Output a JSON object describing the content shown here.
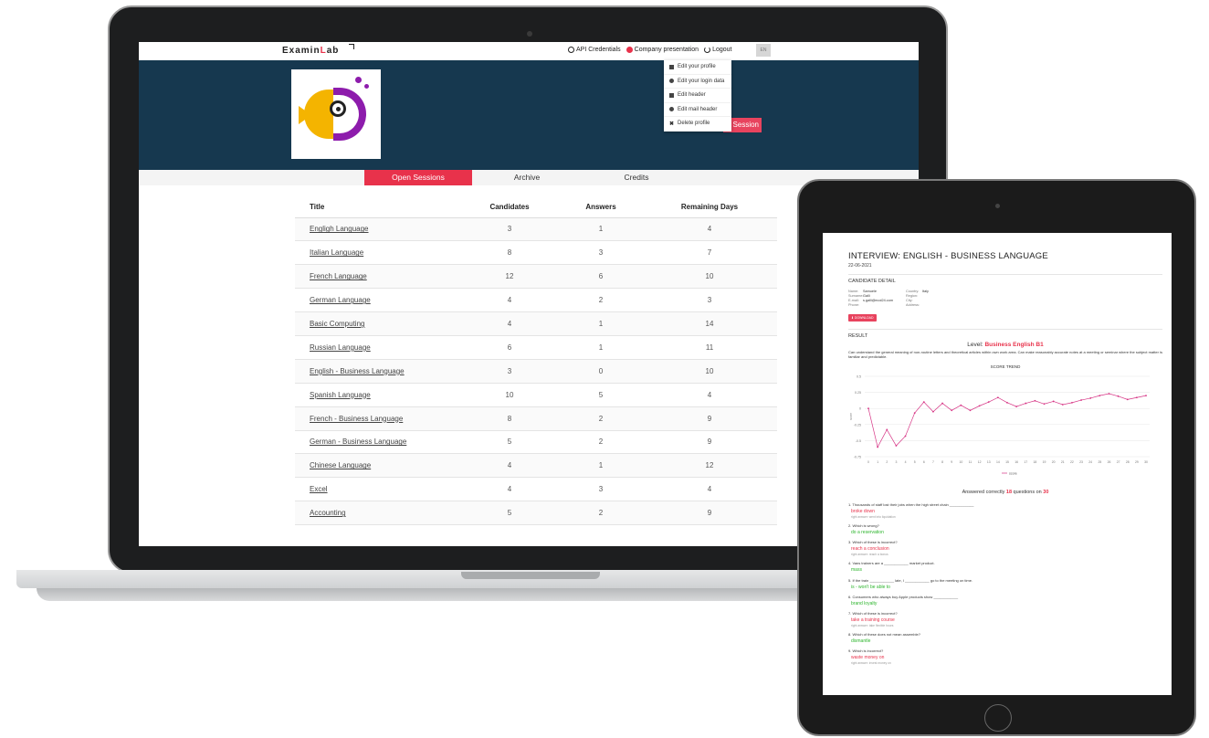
{
  "laptop": {
    "brand_left": "Examin",
    "brand_accent": "L",
    "brand_right": "ab",
    "nav": {
      "api": "API Credentials",
      "company": "Company presentation",
      "logout": "Logout"
    },
    "lang_label": "EN",
    "dropdown": [
      {
        "label": "Edit your profile",
        "icon": "list-icon"
      },
      {
        "label": "Edit your login data",
        "icon": "user-icon"
      },
      {
        "label": "Edit header",
        "icon": "image-icon"
      },
      {
        "label": "Edit mail header",
        "icon": "mail-icon"
      },
      {
        "label": "Delete profile",
        "icon": "close-icon"
      }
    ],
    "session_button": "Session",
    "tabs": [
      "Open Sessions",
      "Archive",
      "Credits"
    ],
    "table": {
      "headers": [
        "Title",
        "Candidates",
        "Answers",
        "Remaining Days"
      ],
      "rows": [
        [
          "Engligh Language",
          "3",
          "1",
          "4"
        ],
        [
          "Italian Language",
          "8",
          "3",
          "7"
        ],
        [
          "French Language",
          "12",
          "6",
          "10"
        ],
        [
          "German Language",
          "4",
          "2",
          "3"
        ],
        [
          "Basic Computing",
          "4",
          "1",
          "14"
        ],
        [
          "Russian Language",
          "6",
          "1",
          "11"
        ],
        [
          "English - Business Language",
          "3",
          "0",
          "10"
        ],
        [
          "Spanish Language",
          "10",
          "5",
          "4"
        ],
        [
          "French - Business Language",
          "8",
          "2",
          "9"
        ],
        [
          "German - Business Language",
          "5",
          "2",
          "9"
        ],
        [
          "Chinese Language",
          "4",
          "1",
          "12"
        ],
        [
          "Excel",
          "4",
          "3",
          "4"
        ],
        [
          "Accounting",
          "5",
          "2",
          "9"
        ]
      ]
    }
  },
  "tablet": {
    "title": "INTERVIEW: ENGLISH - BUSINESS LANGUAGE",
    "date": "22-06-2021",
    "candidate_section": "CANDIDATE DETAIL",
    "candidate": {
      "name_label": "Name:",
      "name": "Samuele",
      "surname_label": "Surname:",
      "surname": "Galli",
      "email_label": "E-mail:",
      "email": "s.galli@ecol24.com",
      "phone_label": "Phone:",
      "phone": "",
      "country_label": "Country:",
      "country": "Italy",
      "region_label": "Region:",
      "region": "",
      "city_label": "City:",
      "city": "",
      "address_label": "Address:",
      "address": ""
    },
    "download_label": "DOWNLOAD",
    "result_section": "RESULT",
    "level_prefix": "Level:",
    "level": "Business English B1",
    "level_description": "Can understand the general meaning of non-routine letters and theoretical articles within own work area. Can make reasonably accurate notes at a meeting or seminar where the subject matter is familiar and predictable.",
    "answered_prefix": "Answered correctly",
    "answered_count": "18",
    "answered_mid": "questions on",
    "answered_total": "30",
    "questions": [
      {
        "text": "1. Thousands of staff lost their jobs when the high street chain ____________",
        "answer": "broke down",
        "status": "wrong",
        "right": "right answer: went into liquidation"
      },
      {
        "text": "2. Which is wrong?",
        "answer": "do a reservation",
        "status": "correct",
        "right": ""
      },
      {
        "text": "3. Which of these is incorrect?",
        "answer": "reach a conclusion",
        "status": "wrong",
        "right": "right answer: reach a bonus"
      },
      {
        "text": "4. Vans trainers are a ____________ market product.",
        "answer": "mass",
        "status": "correct",
        "right": ""
      },
      {
        "text": "5. If the train ____________ late, I ____________ go to the meeting on time.",
        "answer": "is - won't be able to",
        "status": "correct",
        "right": ""
      },
      {
        "text": "6. Consumers who always buy Apple products show ____________",
        "answer": "brand loyalty",
        "status": "correct",
        "right": ""
      },
      {
        "text": "7. Which of these is incorrect?",
        "answer": "take a training course",
        "status": "wrong",
        "right": "right answer: take flexible hours"
      },
      {
        "text": "8. Which of these does not mean assemble?",
        "answer": "dismantle",
        "status": "correct",
        "right": ""
      },
      {
        "text": "9. Which is incorrect?",
        "answer": "waste money on",
        "status": "wrong",
        "right": "right answer: invest money on"
      }
    ],
    "chart_data": {
      "type": "line",
      "title": "SCORE TREND",
      "ylabel": "score",
      "legend": "score",
      "legend_position": "bottom",
      "color": "#d63384",
      "x": [
        0,
        1,
        2,
        3,
        4,
        5,
        6,
        7,
        8,
        9,
        10,
        11,
        12,
        13,
        14,
        15,
        16,
        17,
        18,
        19,
        20,
        21,
        22,
        23,
        24,
        25,
        26,
        27,
        28,
        29,
        30
      ],
      "y": [
        0,
        -0.6,
        -0.33,
        -0.58,
        -0.43,
        -0.07,
        0.1,
        -0.05,
        0.08,
        -0.03,
        0.05,
        -0.03,
        0.04,
        0.1,
        0.17,
        0.09,
        0.03,
        0.08,
        0.12,
        0.07,
        0.11,
        0.06,
        0.09,
        0.13,
        0.16,
        0.2,
        0.23,
        0.19,
        0.14,
        0.17,
        0.2
      ],
      "yticks": [
        0.5,
        0.25,
        0,
        -0.25,
        -0.5,
        -0.75
      ],
      "ytick_labels": [
        "0.5",
        "0.25",
        "0",
        "-0.25",
        "-0.5",
        "-0.75"
      ],
      "ylim": [
        -0.75,
        0.5
      ],
      "grid": true
    }
  }
}
